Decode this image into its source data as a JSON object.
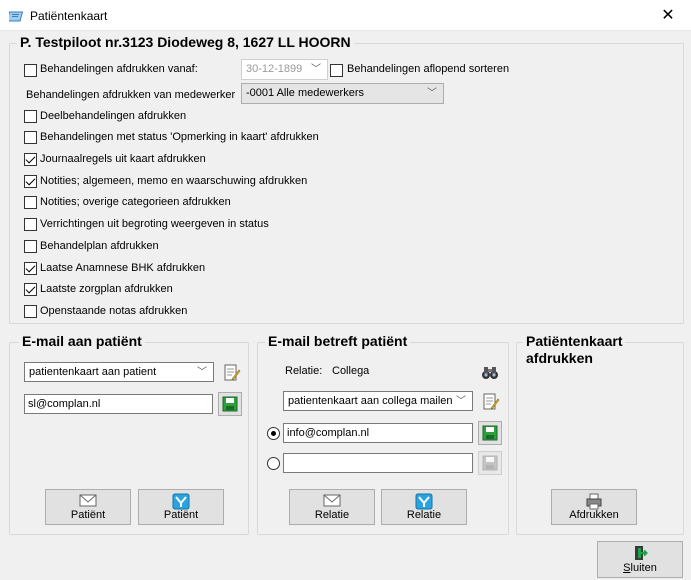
{
  "window": {
    "title": "Patiëntenkaart",
    "close_glyph": "✕"
  },
  "header": {
    "patient_title": "P. Testpiloot nr.3123 Diodeweg 8, 1627 LL HOORN"
  },
  "options": {
    "print_from_label": "Behandelingen afdrukken vanaf:",
    "print_from_date": "30-12-1899",
    "sort_desc_label": "Behandelingen aflopend sorteren",
    "employee_label": "Behandelingen afdrukken van medewerker",
    "employee_value": "-0001 Alle medewerkers",
    "checkboxes": [
      {
        "label": "Deelbehandelingen afdrukken",
        "checked": false
      },
      {
        "label": "Behandelingen met status 'Opmerking in kaart' afdrukken",
        "checked": false
      },
      {
        "label": "Journaalregels uit kaart afdrukken",
        "checked": true
      },
      {
        "label": "Notities; algemeen, memo en waarschuwing afdrukken",
        "checked": true
      },
      {
        "label": "Notities; overige categorieen afdrukken",
        "checked": false
      },
      {
        "label": "Verrichtingen uit begroting weergeven in status",
        "checked": false
      },
      {
        "label": "Behandelplan afdrukken",
        "checked": false
      },
      {
        "label": "Laatse Anamnese BHK afdrukken",
        "checked": true
      },
      {
        "label": "Laatste zorgplan afdrukken",
        "checked": true
      },
      {
        "label": "Openstaande notas afdrukken",
        "checked": false
      }
    ]
  },
  "email_patient": {
    "title": "E-mail aan patiënt",
    "template_value": "patientenkaart aan patient",
    "email_value": "sl@complan.nl",
    "btn_envelope_label": "Patiënt",
    "btn_send_label": "Patiënt"
  },
  "email_regarding": {
    "title": "E-mail betreft patiënt",
    "relation_label": "Relatie:",
    "relation_value": "Collega",
    "template_value": "patientenkaart aan collega mailen",
    "email1_value": "info@complan.nl",
    "email2_value": "",
    "btn_envelope_label": "Relatie",
    "btn_send_label": "Relatie"
  },
  "print_card": {
    "title_line1": "Patiëntenkaart",
    "title_line2": "afdrukken",
    "btn_label": "Afdrukken"
  },
  "footer": {
    "close_label": "Sluiten",
    "close_accel": "S",
    "close_rest": "luiten"
  }
}
